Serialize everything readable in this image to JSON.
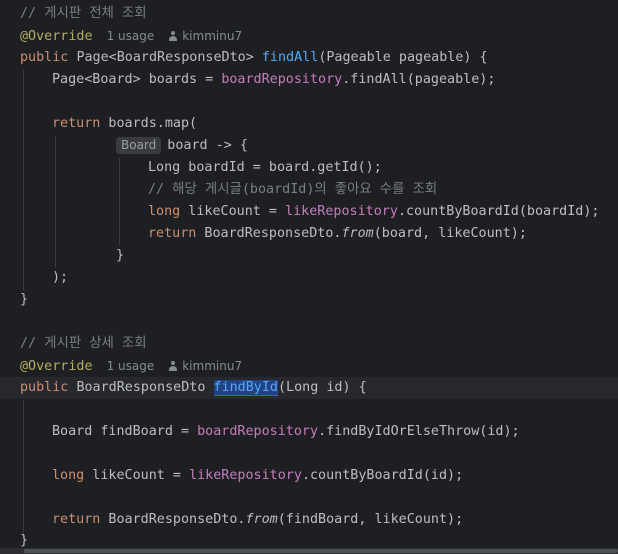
{
  "method1": {
    "comment": "// 게시판 전체 조회",
    "annotation": "@Override",
    "usages": "1 usage",
    "author": "kimminu7",
    "sig_public": "public",
    "sig_type": "Page<BoardResponseDto>",
    "sig_name": "findAll",
    "sig_params": "(Pageable pageable) {",
    "l_boards_type": "Page<Board> boards = ",
    "l_boards_field": "boardRepository",
    "l_boards_call": ".findAll(pageable);",
    "return_kw": "return",
    "return_rest": " boards.map(",
    "lambda_hint": "Board",
    "lambda_rest": "board -> {",
    "l_id": "Long boardId = board.getId();",
    "l_comment": "// 해당 게시글(boardId)의 좋아요 수를 조회",
    "l_like_kw": "long",
    "l_like_mid": " likeCount = ",
    "l_like_field": "likeRepository",
    "l_like_call": ".countByBoardId(boardId);",
    "l_ret_kw": "return",
    "l_ret_a": " BoardResponseDto.",
    "l_ret_fn": "from",
    "l_ret_b": "(board, likeCount);",
    "close_lambda": "}",
    "close_map": ");",
    "close_method": "}"
  },
  "method2": {
    "comment": "// 게시판 상세 조회",
    "annotation": "@Override",
    "usages": "1 usage",
    "author": "kimminu7",
    "sig_public": "public",
    "sig_type": "BoardResponseDto",
    "sig_name": "findById",
    "sig_params": "(Long id) {",
    "l_find_a": "Board findBoard = ",
    "l_find_field": "boardRepository",
    "l_find_call": ".findByIdOrElseThrow(id);",
    "l_like_kw": "long",
    "l_like_mid": " likeCount = ",
    "l_like_field": "likeRepository",
    "l_like_call": ".countByBoardId(id);",
    "l_ret_kw": "return",
    "l_ret_a": " BoardResponseDto.",
    "l_ret_fn": "from",
    "l_ret_b": "(findBoard, likeCount);",
    "close_method": "}"
  }
}
